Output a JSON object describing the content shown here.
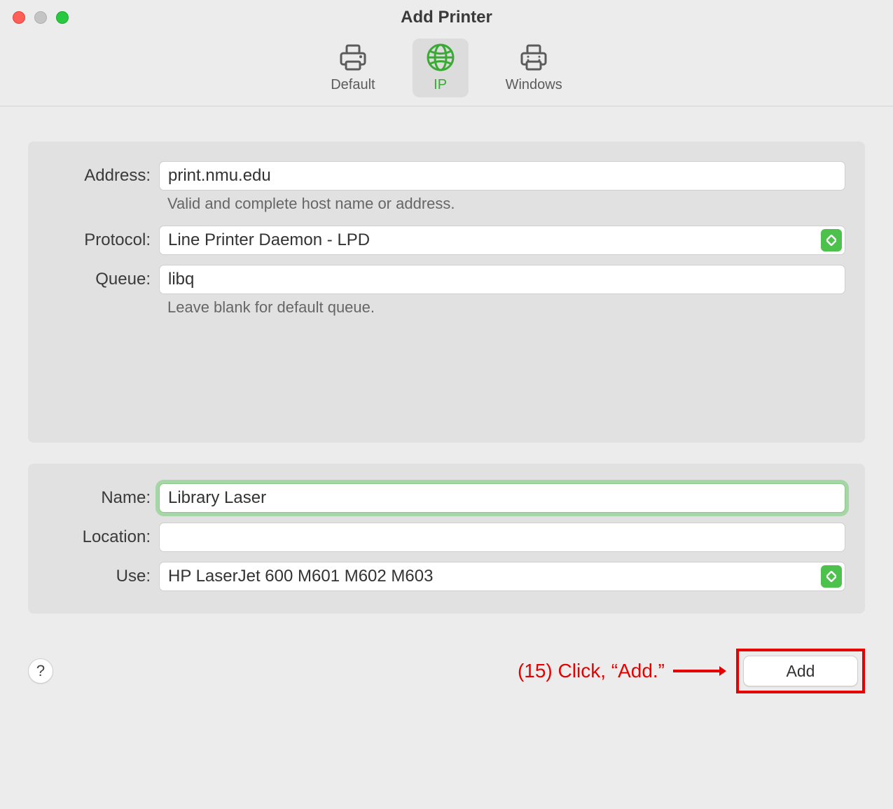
{
  "window": {
    "title": "Add Printer"
  },
  "toolbar": {
    "items": [
      {
        "label": "Default",
        "selected": false
      },
      {
        "label": "IP",
        "selected": true
      },
      {
        "label": "Windows",
        "selected": false
      }
    ]
  },
  "form": {
    "address": {
      "label": "Address:",
      "value": "print.nmu.edu",
      "hint": "Valid and complete host name or address."
    },
    "protocol": {
      "label": "Protocol:",
      "value": "Line Printer Daemon - LPD"
    },
    "queue": {
      "label": "Queue:",
      "value": "libq",
      "hint": "Leave blank for default queue."
    },
    "name": {
      "label": "Name:",
      "value": "Library Laser"
    },
    "location": {
      "label": "Location:",
      "value": ""
    },
    "use": {
      "label": "Use:",
      "value": "HP LaserJet 600 M601 M602 M603"
    }
  },
  "buttons": {
    "help": "?",
    "add": "Add"
  },
  "annotation": {
    "text": "(15) Click, “Add.”"
  },
  "colors": {
    "accent": "#4cc14c",
    "annotation": "#e60000"
  }
}
